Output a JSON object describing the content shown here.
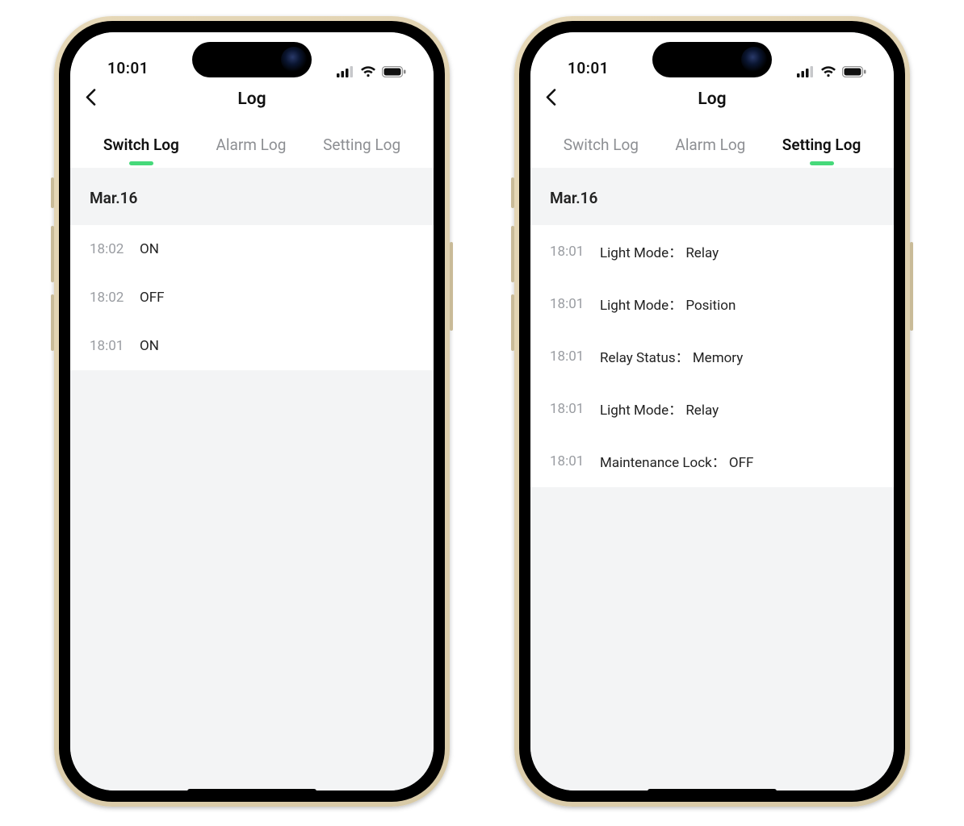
{
  "status": {
    "time": "10:01"
  },
  "header": {
    "title": "Log"
  },
  "tabs": {
    "switch": "Switch Log",
    "alarm": "Alarm Log",
    "setting": "Setting Log"
  },
  "phone1": {
    "activeTab": "switch",
    "date": "Mar.16",
    "rows": [
      {
        "time": "18:02",
        "text": "ON"
      },
      {
        "time": "18:02",
        "text": "OFF"
      },
      {
        "time": "18:01",
        "text": "ON"
      }
    ]
  },
  "phone2": {
    "activeTab": "setting",
    "date": "Mar.16",
    "rows": [
      {
        "time": "18:01",
        "text": "Light Mode： Relay"
      },
      {
        "time": "18:01",
        "text": "Light Mode： Position"
      },
      {
        "time": "18:01",
        "text": "Relay Status： Memory"
      },
      {
        "time": "18:01",
        "text": "Light Mode： Relay"
      },
      {
        "time": "18:01",
        "text": "Maintenance Lock： OFF"
      }
    ]
  }
}
